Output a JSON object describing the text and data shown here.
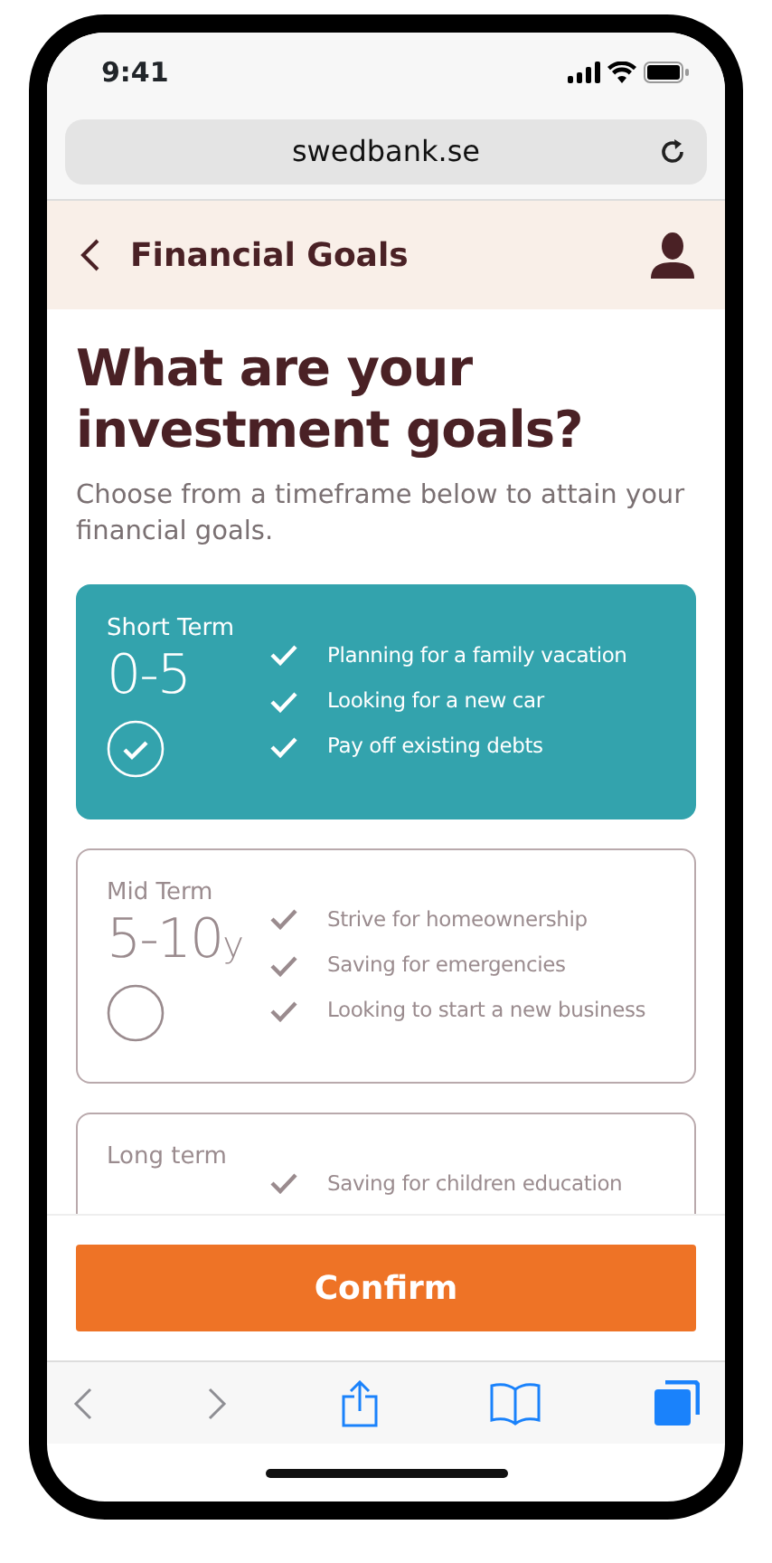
{
  "status_bar": {
    "time": "9:41"
  },
  "browser": {
    "url": "swedbank.se"
  },
  "header": {
    "title": "Financial Goals"
  },
  "heading": "What are your investment goals?",
  "subtitle": "Choose from a timeframe below to attain your financial goals.",
  "options": [
    {
      "label": "Short Term",
      "range": "0-5",
      "selected": true,
      "goals": [
        "Planning for a family vacation",
        "Looking for a new car",
        "Pay off existing debts"
      ]
    },
    {
      "label": "Mid Term",
      "range": "5-10$_{y}$",
      "selected": false,
      "goals": [
        "Strive for homeownership",
        "Saving for emergencies",
        "Looking to start a new business"
      ]
    },
    {
      "label": "Long term",
      "selected": false,
      "goals": [
        "Saving for children education"
      ]
    }
  ],
  "confirm_button": "Confirm"
}
